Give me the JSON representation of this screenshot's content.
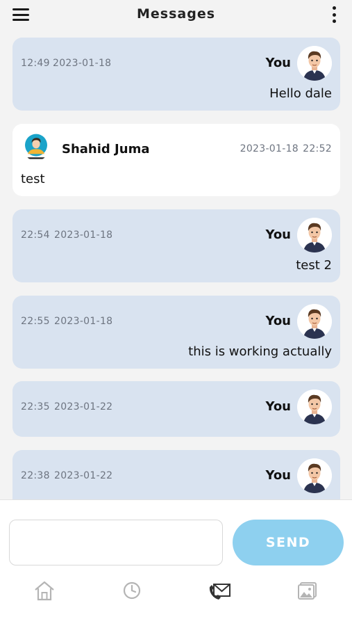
{
  "header": {
    "title": "Messages",
    "menu_icon": "hamburger-menu-icon",
    "more_icon": "vertical-dots-icon"
  },
  "messages": [
    {
      "mine": true,
      "time": "12:49",
      "date": "2023-01-18",
      "sender": "You",
      "text": "Hello dale"
    },
    {
      "mine": false,
      "time": "22:52",
      "date": "2023-01-18",
      "sender": "Shahid Juma",
      "text": "test"
    },
    {
      "mine": true,
      "time": "22:54",
      "date": "2023-01-18",
      "sender": "You",
      "text": "test 2"
    },
    {
      "mine": true,
      "time": "22:55",
      "date": "2023-01-18",
      "sender": "You",
      "text": "this is working actually"
    },
    {
      "mine": true,
      "time": "22:35",
      "date": "2023-01-22",
      "sender": "You",
      "text": ""
    },
    {
      "mine": true,
      "time": "22:38",
      "date": "2023-01-22",
      "sender": "You",
      "text": ""
    }
  ],
  "composer": {
    "input_value": "",
    "send_label": "SEND"
  },
  "bottom_nav": [
    {
      "icon": "home-icon",
      "active": false
    },
    {
      "icon": "clock-icon",
      "active": false
    },
    {
      "icon": "mail-phone-icon",
      "active": true
    },
    {
      "icon": "gallery-icon",
      "active": false
    }
  ],
  "colors": {
    "own_bubble": "#d9e3f0",
    "other_bubble": "#ffffff",
    "send_button": "#8ed0ef",
    "meta_text": "#6d7480"
  }
}
